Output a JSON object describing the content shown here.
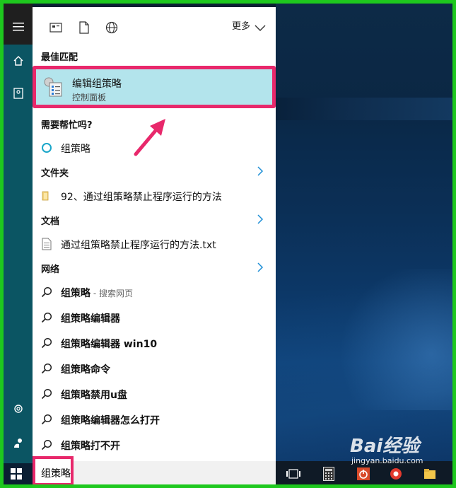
{
  "toolbar": {
    "more_label": "更多"
  },
  "sections": {
    "best_match": "最佳匹配",
    "need_help": "需要帮忙吗?",
    "folders": "文件夹",
    "documents": "文档",
    "web": "网络"
  },
  "best_match": {
    "title": "编辑组策略",
    "subtitle": "控制面板"
  },
  "help_item": "组策略",
  "folder_item": "92、通过组策略禁止程序运行的方法",
  "document_item": "通过组策略禁止程序运行的方法.txt",
  "web_items": [
    {
      "bold": "组策略",
      "suffix": " - 搜索网页"
    },
    {
      "bold": "组策略编辑器",
      "suffix": ""
    },
    {
      "bold": "组策略编辑器 win10",
      "suffix": ""
    },
    {
      "bold": "组策略命令",
      "suffix": ""
    },
    {
      "bold": "组策略禁用u盘",
      "suffix": ""
    },
    {
      "bold": "组策略编辑器怎么打开",
      "suffix": ""
    },
    {
      "bold": "组策略打不开",
      "suffix": ""
    }
  ],
  "search": {
    "query": "组策略"
  },
  "watermark": {
    "logo": "Bai经验",
    "url": "jingyan.baidu.com"
  },
  "colors": {
    "frame": "#1ec81e",
    "highlight": "#e8286b",
    "best_match_bg": "#b3e4ec",
    "rail_accent": "#0b5563"
  }
}
